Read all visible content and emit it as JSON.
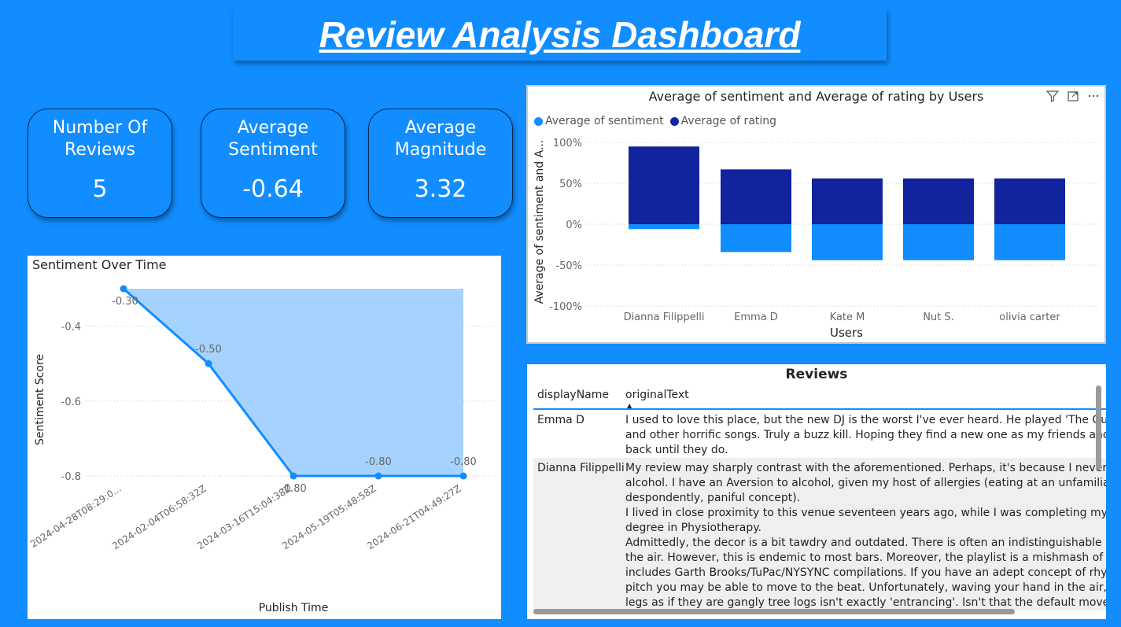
{
  "dashboard": {
    "title": "Review Analysis Dashboard"
  },
  "kpis": [
    {
      "label": "Number Of Reviews",
      "value": "5"
    },
    {
      "label": "Average Sentiment",
      "value": "-0.64"
    },
    {
      "label": "Average Magnitude",
      "value": "3.32"
    }
  ],
  "colors": {
    "background": "#118DFF",
    "sentiment": "#118DFF",
    "rating": "#12239E",
    "area": "#A1D0FF"
  },
  "icons": [
    "filter-icon",
    "focus-mode-icon",
    "more-options-icon"
  ],
  "chart_data": [
    {
      "type": "area",
      "title": "Sentiment Over Time",
      "xlabel": "Publish Time",
      "ylabel": "Sentiment Score",
      "categories": [
        "2024-04-28T08:29:0...",
        "2024-02-04T06:58:32Z",
        "2024-03-16T15:04:38Z",
        "2024-05-19T05:48:58Z",
        "2024-06-21T04:49:27Z"
      ],
      "values": [
        -0.3,
        -0.5,
        -0.8,
        -0.8,
        -0.8
      ],
      "data_labels": [
        "-0.30",
        "-0.50",
        "-0.80",
        "-0.80",
        "-0.80"
      ],
      "yticks": [
        -0.4,
        -0.6,
        -0.8
      ],
      "ytick_labels": [
        "-0.4",
        "-0.6",
        "-0.8"
      ],
      "ylim": [
        -0.8,
        -0.3
      ],
      "grid": true
    },
    {
      "type": "bar",
      "stacked": true,
      "title": "Average of sentiment and Average of rating by Users",
      "xlabel": "Users",
      "ylabel": "Average of sentiment and A...",
      "categories": [
        "Dianna Filippelli",
        "Emma D",
        "Kate M",
        "Nut S.",
        "olivia carter"
      ],
      "series": [
        {
          "name": "Average of sentiment",
          "values": [
            -0.06,
            -0.34,
            -0.44,
            -0.44,
            -0.44
          ]
        },
        {
          "name": "Average of rating",
          "values": [
            0.95,
            0.67,
            0.56,
            0.56,
            0.56
          ]
        }
      ],
      "yticks": [
        1,
        0.5,
        0,
        -0.5,
        -1
      ],
      "ytick_labels": [
        "100%",
        "50%",
        "0%",
        "-50%",
        "-100%"
      ],
      "ylim": [
        -1,
        1
      ],
      "legend": "top-left",
      "grid": true
    }
  ],
  "reviews": {
    "title": "Reviews",
    "columns": [
      "displayName",
      "originalText"
    ],
    "rows": [
      {
        "name": "Emma D",
        "lines": [
          "I used to love this place, but the new DJ is the worst I've ever heard. He played 'The Gumr",
          "and other horrific songs. Truly a buzz kill. Hoping they find a new one as my friends and I",
          "back until they do."
        ]
      },
      {
        "name": "Dianna Filippelli",
        "lines": [
          "My review may sharply contrast with the aforementioned. Perhaps, it's because I never co",
          "alcohol. I have an Aversion to alcohol, given my host of allergies (eating at an unfamiliar r",
          "despondently, paniful concept).",
          "I lived in close proximity to this venue seventeen years ago, while I was completing my Ma",
          "degree in Physiotherapy.",
          "Admittedly, the decor is a bit tawdry and outdated. There is often an indistinguishable od",
          "the air. However, this is endemic to most bars. Moreover, the playlist is a mishmash of retr",
          "includes Garth Brooks/TuPac/NYSYNC compilations. If you have an adept concept of rhyth",
          "pitch you may be able to move to the beat. Unfortunately, waving your hand in the air, an",
          "legs as if they are gangly tree logs isn't exactly 'entrancing'. Isn't that the default move of"
        ]
      }
    ]
  }
}
